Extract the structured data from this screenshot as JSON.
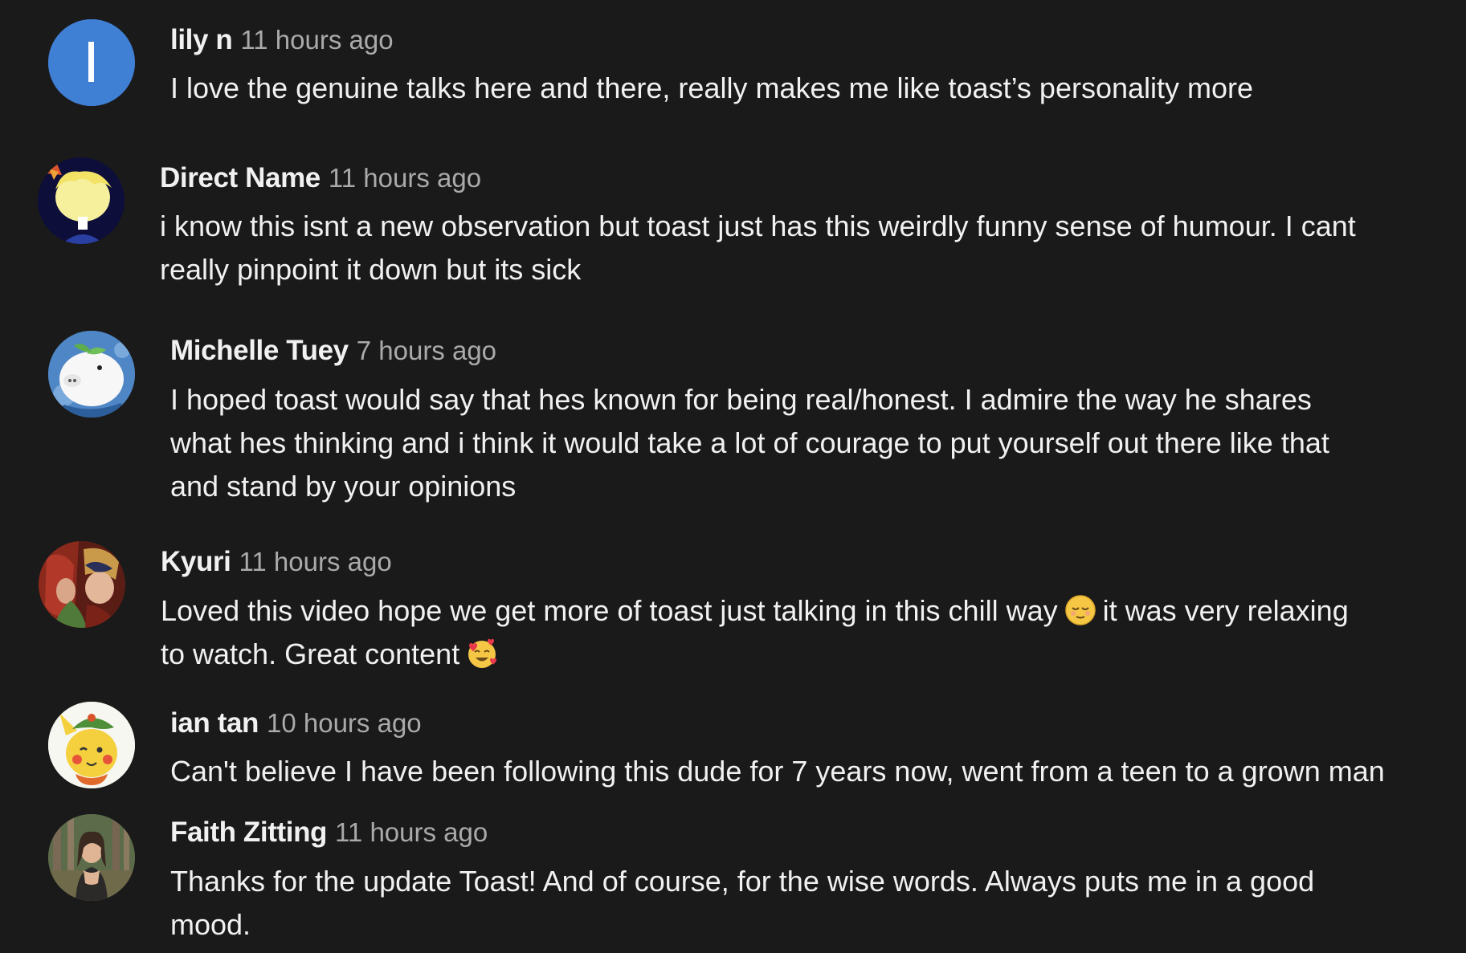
{
  "comments": [
    {
      "author": "lily n",
      "time": "11 hours ago",
      "avatar": {
        "type": "initial",
        "letter": "l",
        "color": "#3f7fd4"
      },
      "lines": [
        "I love the genuine talks here and there, really makes me like toast’s personality more"
      ]
    },
    {
      "author": "Direct Name",
      "time": "11 hours ago",
      "avatar": {
        "type": "image",
        "icon": "cartoon-blond-character-icon"
      },
      "lines": [
        "i know this isnt a new observation but toast just has this weirdly funny sense of humour. I cant",
        "really pinpoint it down but its sick"
      ]
    },
    {
      "author": "Michelle Tuey",
      "time": "7 hours ago",
      "avatar": {
        "type": "image",
        "icon": "white-piglet-icon"
      },
      "lines": [
        "I hoped toast would say that hes known for being real/honest. I admire the way he shares",
        "what hes thinking and i think it would take a lot of courage to put yourself out there like that",
        "and stand by your opinions"
      ]
    },
    {
      "author": "Kyuri",
      "time": "11 hours ago",
      "avatar": {
        "type": "image",
        "icon": "anime-couple-icon"
      },
      "line1_a": "Loved this video hope we get more of toast just talking in this chill way",
      "line1_b": "it was very relaxing",
      "line2_a": "to watch. Great content",
      "emoji1": "relieved-face-emoji",
      "emoji2": "smiling-face-with-hearts-emoji"
    },
    {
      "author": "ian tan",
      "time": "10 hours ago",
      "avatar": {
        "type": "image",
        "icon": "pikachu-teemo-hat-icon"
      },
      "lines": [
        "Can't believe I have been following this dude for 7 years now, went from a teen to a grown man"
      ]
    },
    {
      "author": "Faith Zitting",
      "time": "11 hours ago",
      "avatar": {
        "type": "image",
        "icon": "person-in-forest-photo-icon"
      },
      "lines": [
        "Thanks for the update Toast! And of course, for the wise words. Always puts me in a good",
        "mood."
      ]
    }
  ]
}
